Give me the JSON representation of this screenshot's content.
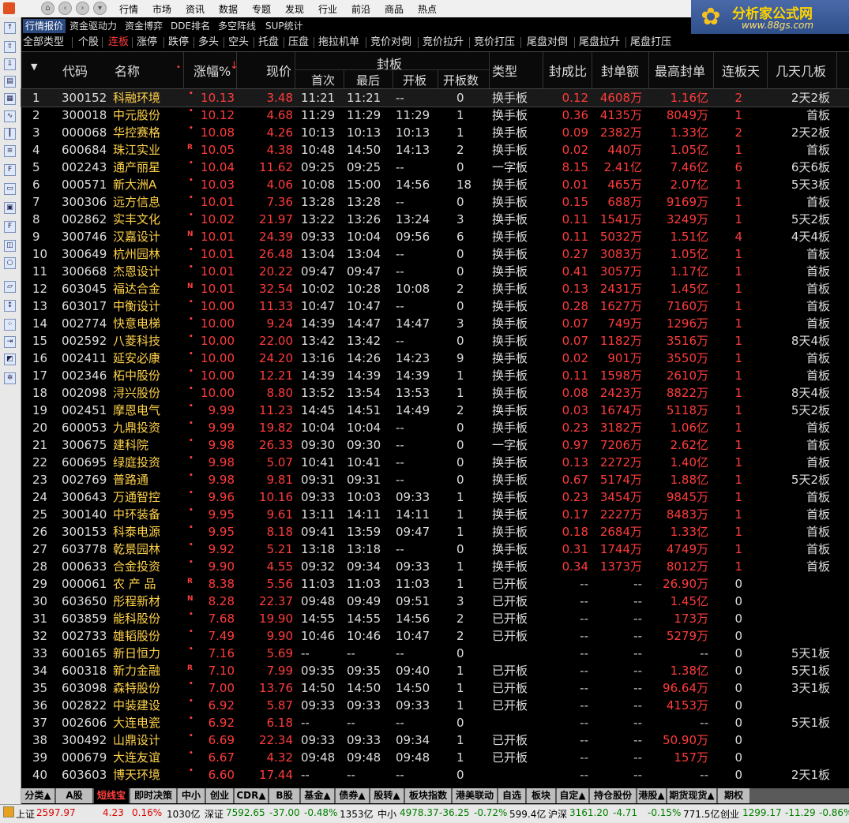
{
  "menubar": {
    "items": [
      "行情",
      "市场",
      "资讯",
      "数据",
      "专题",
      "发现",
      "行业",
      "前沿",
      "商品",
      "热点"
    ]
  },
  "brand": {
    "name": "分析家公式网",
    "url": "www.88gs.com"
  },
  "tabs_top": [
    "行情报价",
    "资金驱动力",
    "资金博弈",
    "DDE排名",
    "多空阵线",
    "SUP统计"
  ],
  "tabs_second": [
    {
      "label": "全部类型",
      "color": "w"
    },
    {
      "label": "个股",
      "color": "w"
    },
    {
      "label": "连板",
      "color": "r"
    },
    {
      "label": "涨停",
      "color": "w"
    },
    {
      "label": "跌停",
      "color": "w"
    },
    {
      "label": "多头",
      "color": "w"
    },
    {
      "label": "空头",
      "color": "w"
    },
    {
      "label": "托盘",
      "color": "w"
    },
    {
      "label": "压盘",
      "color": "w"
    },
    {
      "label": "拖拉机单",
      "color": "w"
    },
    {
      "label": "竞价对倒",
      "color": "w"
    },
    {
      "label": "竞价拉升",
      "color": "w"
    },
    {
      "label": "竞价打压",
      "color": "w"
    },
    {
      "label": "尾盘对倒",
      "color": "w"
    },
    {
      "label": "尾盘拉升",
      "color": "w"
    },
    {
      "label": "尾盘打压",
      "color": "w"
    }
  ],
  "columns": {
    "code": "代码",
    "name": "名称",
    "pct": "涨幅%",
    "price": "现价",
    "seal": "封板",
    "first": "首次",
    "last": "最后",
    "open": "开板",
    "opencount": "开板数",
    "type": "类型",
    "ratio": "封成比",
    "amount": "封单额",
    "maxseal": "最高封单",
    "days": "连板天",
    "nboards": "几天几板"
  },
  "rows": [
    {
      "n": "1",
      "code": "300152",
      "name": "科融环境",
      "mk": "",
      "pct": "10.13",
      "price": "3.48",
      "first": "11:21",
      "last": "11:21",
      "open": "--",
      "oc": "0",
      "type": "换手板",
      "ratio": "0.12",
      "amt": "4608万",
      "max": "1.16亿",
      "days": "2",
      "nb": "2天2板"
    },
    {
      "n": "2",
      "code": "300018",
      "name": "中元股份",
      "mk": "",
      "pct": "10.12",
      "price": "4.68",
      "first": "11:29",
      "last": "11:29",
      "open": "11:29",
      "oc": "1",
      "type": "换手板",
      "ratio": "0.36",
      "amt": "4135万",
      "max": "8049万",
      "days": "1",
      "nb": "首板"
    },
    {
      "n": "3",
      "code": "000068",
      "name": "华控赛格",
      "mk": "",
      "pct": "10.08",
      "price": "4.26",
      "first": "10:13",
      "last": "10:13",
      "open": "10:13",
      "oc": "1",
      "type": "换手板",
      "ratio": "0.09",
      "amt": "2382万",
      "max": "1.33亿",
      "days": "2",
      "nb": "2天2板"
    },
    {
      "n": "4",
      "code": "600684",
      "name": "珠江实业",
      "mk": "R",
      "pct": "10.05",
      "price": "4.38",
      "first": "10:48",
      "last": "14:50",
      "open": "14:13",
      "oc": "2",
      "type": "换手板",
      "ratio": "0.02",
      "amt": "440万",
      "max": "1.05亿",
      "days": "1",
      "nb": "首板"
    },
    {
      "n": "5",
      "code": "002243",
      "name": "通产丽星",
      "mk": "",
      "pct": "10.04",
      "price": "11.62",
      "first": "09:25",
      "last": "09:25",
      "open": "--",
      "oc": "0",
      "type": "一字板",
      "ratio": "8.15",
      "amt": "2.41亿",
      "max": "7.46亿",
      "days": "6",
      "nb": "6天6板"
    },
    {
      "n": "6",
      "code": "000571",
      "name": "新大洲A",
      "mk": "",
      "pct": "10.03",
      "price": "4.06",
      "first": "10:08",
      "last": "15:00",
      "open": "14:56",
      "oc": "18",
      "type": "换手板",
      "ratio": "0.01",
      "amt": "465万",
      "max": "2.07亿",
      "days": "1",
      "nb": "5天3板"
    },
    {
      "n": "7",
      "code": "300306",
      "name": "远方信息",
      "mk": "",
      "pct": "10.01",
      "price": "7.36",
      "first": "13:28",
      "last": "13:28",
      "open": "--",
      "oc": "0",
      "type": "换手板",
      "ratio": "0.15",
      "amt": "688万",
      "max": "9169万",
      "days": "1",
      "nb": "首板"
    },
    {
      "n": "8",
      "code": "002862",
      "name": "实丰文化",
      "mk": "",
      "pct": "10.02",
      "price": "21.97",
      "first": "13:22",
      "last": "13:26",
      "open": "13:24",
      "oc": "3",
      "type": "换手板",
      "ratio": "0.11",
      "amt": "1541万",
      "max": "3249万",
      "days": "1",
      "nb": "5天2板"
    },
    {
      "n": "9",
      "code": "300746",
      "name": "汉嘉设计",
      "mk": "N",
      "pct": "10.01",
      "price": "24.39",
      "first": "09:33",
      "last": "10:04",
      "open": "09:56",
      "oc": "6",
      "type": "换手板",
      "ratio": "0.11",
      "amt": "5032万",
      "max": "1.51亿",
      "days": "4",
      "nb": "4天4板"
    },
    {
      "n": "10",
      "code": "300649",
      "name": "杭州园林",
      "mk": "",
      "pct": "10.01",
      "price": "26.48",
      "first": "13:04",
      "last": "13:04",
      "open": "--",
      "oc": "0",
      "type": "换手板",
      "ratio": "0.27",
      "amt": "3083万",
      "max": "1.05亿",
      "days": "1",
      "nb": "首板"
    },
    {
      "n": "11",
      "code": "300668",
      "name": "杰恩设计",
      "mk": "",
      "pct": "10.01",
      "price": "20.22",
      "first": "09:47",
      "last": "09:47",
      "open": "--",
      "oc": "0",
      "type": "换手板",
      "ratio": "0.41",
      "amt": "3057万",
      "max": "1.17亿",
      "days": "1",
      "nb": "首板"
    },
    {
      "n": "12",
      "code": "603045",
      "name": "福达合金",
      "mk": "N",
      "pct": "10.01",
      "price": "32.54",
      "first": "10:02",
      "last": "10:28",
      "open": "10:08",
      "oc": "2",
      "type": "换手板",
      "ratio": "0.13",
      "amt": "2431万",
      "max": "1.45亿",
      "days": "1",
      "nb": "首板"
    },
    {
      "n": "13",
      "code": "603017",
      "name": "中衡设计",
      "mk": "",
      "pct": "10.00",
      "price": "11.33",
      "first": "10:47",
      "last": "10:47",
      "open": "--",
      "oc": "0",
      "type": "换手板",
      "ratio": "0.28",
      "amt": "1627万",
      "max": "7160万",
      "days": "1",
      "nb": "首板"
    },
    {
      "n": "14",
      "code": "002774",
      "name": "快意电梯",
      "mk": "",
      "pct": "10.00",
      "price": "9.24",
      "first": "14:39",
      "last": "14:47",
      "open": "14:47",
      "oc": "3",
      "type": "换手板",
      "ratio": "0.07",
      "amt": "749万",
      "max": "1296万",
      "days": "1",
      "nb": "首板"
    },
    {
      "n": "15",
      "code": "002592",
      "name": "八菱科技",
      "mk": "",
      "pct": "10.00",
      "price": "22.00",
      "first": "13:42",
      "last": "13:42",
      "open": "--",
      "oc": "0",
      "type": "换手板",
      "ratio": "0.07",
      "amt": "1182万",
      "max": "3516万",
      "days": "1",
      "nb": "8天4板"
    },
    {
      "n": "16",
      "code": "002411",
      "name": "延安必康",
      "mk": "",
      "pct": "10.00",
      "price": "24.20",
      "first": "13:16",
      "last": "14:26",
      "open": "14:23",
      "oc": "9",
      "type": "换手板",
      "ratio": "0.02",
      "amt": "901万",
      "max": "3550万",
      "days": "1",
      "nb": "首板"
    },
    {
      "n": "17",
      "code": "002346",
      "name": "柘中股份",
      "mk": "",
      "pct": "10.00",
      "price": "12.21",
      "first": "14:39",
      "last": "14:39",
      "open": "14:39",
      "oc": "1",
      "type": "换手板",
      "ratio": "0.11",
      "amt": "1598万",
      "max": "2610万",
      "days": "1",
      "nb": "首板"
    },
    {
      "n": "18",
      "code": "002098",
      "name": "浔兴股份",
      "mk": "",
      "pct": "10.00",
      "price": "8.80",
      "first": "13:52",
      "last": "13:54",
      "open": "13:53",
      "oc": "1",
      "type": "换手板",
      "ratio": "0.08",
      "amt": "2423万",
      "max": "8822万",
      "days": "1",
      "nb": "8天4板"
    },
    {
      "n": "19",
      "code": "002451",
      "name": "摩恩电气",
      "mk": "",
      "pct": "9.99",
      "price": "11.23",
      "first": "14:45",
      "last": "14:51",
      "open": "14:49",
      "oc": "2",
      "type": "换手板",
      "ratio": "0.03",
      "amt": "1674万",
      "max": "5118万",
      "days": "1",
      "nb": "5天2板"
    },
    {
      "n": "20",
      "code": "600053",
      "name": "九鼎投资",
      "mk": "",
      "pct": "9.99",
      "price": "19.82",
      "first": "10:04",
      "last": "10:04",
      "open": "--",
      "oc": "0",
      "type": "换手板",
      "ratio": "0.23",
      "amt": "3182万",
      "max": "1.06亿",
      "days": "1",
      "nb": "首板"
    },
    {
      "n": "21",
      "code": "300675",
      "name": "建科院",
      "mk": "",
      "pct": "9.98",
      "price": "26.33",
      "first": "09:30",
      "last": "09:30",
      "open": "--",
      "oc": "0",
      "type": "一字板",
      "ratio": "0.97",
      "amt": "7206万",
      "max": "2.62亿",
      "days": "1",
      "nb": "首板"
    },
    {
      "n": "22",
      "code": "600695",
      "name": "绿庭投资",
      "mk": "",
      "pct": "9.98",
      "price": "5.07",
      "first": "10:41",
      "last": "10:41",
      "open": "--",
      "oc": "0",
      "type": "换手板",
      "ratio": "0.13",
      "amt": "2272万",
      "max": "1.40亿",
      "days": "1",
      "nb": "首板"
    },
    {
      "n": "23",
      "code": "002769",
      "name": "普路通",
      "mk": "",
      "pct": "9.98",
      "price": "9.81",
      "first": "09:31",
      "last": "09:31",
      "open": "--",
      "oc": "0",
      "type": "换手板",
      "ratio": "0.67",
      "amt": "5174万",
      "max": "1.88亿",
      "days": "1",
      "nb": "5天2板"
    },
    {
      "n": "24",
      "code": "300643",
      "name": "万通智控",
      "mk": "",
      "pct": "9.96",
      "price": "10.16",
      "first": "09:33",
      "last": "10:03",
      "open": "09:33",
      "oc": "1",
      "type": "换手板",
      "ratio": "0.23",
      "amt": "3454万",
      "max": "9845万",
      "days": "1",
      "nb": "首板"
    },
    {
      "n": "25",
      "code": "300140",
      "name": "中环装备",
      "mk": "",
      "pct": "9.95",
      "price": "9.61",
      "first": "13:11",
      "last": "14:11",
      "open": "14:11",
      "oc": "1",
      "type": "换手板",
      "ratio": "0.17",
      "amt": "2227万",
      "max": "8483万",
      "days": "1",
      "nb": "首板"
    },
    {
      "n": "26",
      "code": "300153",
      "name": "科泰电源",
      "mk": "",
      "pct": "9.95",
      "price": "8.18",
      "first": "09:41",
      "last": "13:59",
      "open": "09:47",
      "oc": "1",
      "type": "换手板",
      "ratio": "0.18",
      "amt": "2684万",
      "max": "1.33亿",
      "days": "1",
      "nb": "首板"
    },
    {
      "n": "27",
      "code": "603778",
      "name": "乾景园林",
      "mk": "",
      "pct": "9.92",
      "price": "5.21",
      "first": "13:18",
      "last": "13:18",
      "open": "--",
      "oc": "0",
      "type": "换手板",
      "ratio": "0.31",
      "amt": "1744万",
      "max": "4749万",
      "days": "1",
      "nb": "首板"
    },
    {
      "n": "28",
      "code": "000633",
      "name": "合金投资",
      "mk": "",
      "pct": "9.90",
      "price": "4.55",
      "first": "09:32",
      "last": "09:34",
      "open": "09:33",
      "oc": "1",
      "type": "换手板",
      "ratio": "0.34",
      "amt": "1373万",
      "max": "8012万",
      "days": "1",
      "nb": "首板"
    },
    {
      "n": "29",
      "code": "000061",
      "name": "农 产 品",
      "mk": "R",
      "pct": "8.38",
      "price": "5.56",
      "first": "11:03",
      "last": "11:03",
      "open": "11:03",
      "oc": "1",
      "type": "已开板",
      "ratio": "--",
      "amt": "--",
      "max": "26.90万",
      "days": "0",
      "nb": ""
    },
    {
      "n": "30",
      "code": "603650",
      "name": "彤程新材",
      "mk": "N",
      "pct": "8.28",
      "price": "22.37",
      "first": "09:48",
      "last": "09:49",
      "open": "09:51",
      "oc": "3",
      "type": "已开板",
      "ratio": "--",
      "amt": "--",
      "max": "1.45亿",
      "days": "0",
      "nb": ""
    },
    {
      "n": "31",
      "code": "603859",
      "name": "能科股份",
      "mk": "",
      "pct": "7.68",
      "price": "19.90",
      "first": "14:55",
      "last": "14:55",
      "open": "14:56",
      "oc": "2",
      "type": "已开板",
      "ratio": "--",
      "amt": "--",
      "max": "173万",
      "days": "0",
      "nb": ""
    },
    {
      "n": "32",
      "code": "002733",
      "name": "雄韬股份",
      "mk": "",
      "pct": "7.49",
      "price": "9.90",
      "first": "10:46",
      "last": "10:46",
      "open": "10:47",
      "oc": "2",
      "type": "已开板",
      "ratio": "--",
      "amt": "--",
      "max": "5279万",
      "days": "0",
      "nb": ""
    },
    {
      "n": "33",
      "code": "600165",
      "name": "新日恒力",
      "mk": "",
      "pct": "7.16",
      "price": "5.69",
      "first": "--",
      "last": "--",
      "open": "--",
      "oc": "0",
      "type": "",
      "ratio": "--",
      "amt": "--",
      "max": "--",
      "days": "0",
      "nb": "5天1板"
    },
    {
      "n": "34",
      "code": "600318",
      "name": "新力金融",
      "mk": "R",
      "pct": "7.10",
      "price": "7.99",
      "first": "09:35",
      "last": "09:35",
      "open": "09:40",
      "oc": "1",
      "type": "已开板",
      "ratio": "--",
      "amt": "--",
      "max": "1.38亿",
      "days": "0",
      "nb": "5天1板"
    },
    {
      "n": "35",
      "code": "603098",
      "name": "森特股份",
      "mk": "",
      "pct": "7.00",
      "price": "13.76",
      "first": "14:50",
      "last": "14:50",
      "open": "14:50",
      "oc": "1",
      "type": "已开板",
      "ratio": "--",
      "amt": "--",
      "max": "96.64万",
      "days": "0",
      "nb": "3天1板"
    },
    {
      "n": "36",
      "code": "002822",
      "name": "中装建设",
      "mk": "",
      "pct": "6.92",
      "price": "5.87",
      "first": "09:33",
      "last": "09:33",
      "open": "09:33",
      "oc": "1",
      "type": "已开板",
      "ratio": "--",
      "amt": "--",
      "max": "4153万",
      "days": "0",
      "nb": ""
    },
    {
      "n": "37",
      "code": "002606",
      "name": "大连电瓷",
      "mk": "",
      "pct": "6.92",
      "price": "6.18",
      "first": "--",
      "last": "--",
      "open": "--",
      "oc": "0",
      "type": "",
      "ratio": "--",
      "amt": "--",
      "max": "--",
      "days": "0",
      "nb": "5天1板"
    },
    {
      "n": "38",
      "code": "300492",
      "name": "山鼎设计",
      "mk": "",
      "pct": "6.69",
      "price": "22.34",
      "first": "09:33",
      "last": "09:33",
      "open": "09:34",
      "oc": "1",
      "type": "已开板",
      "ratio": "--",
      "amt": "--",
      "max": "50.90万",
      "days": "0",
      "nb": ""
    },
    {
      "n": "39",
      "code": "000679",
      "name": "大连友谊",
      "mk": "",
      "pct": "6.67",
      "price": "4.32",
      "first": "09:48",
      "last": "09:48",
      "open": "09:48",
      "oc": "1",
      "type": "已开板",
      "ratio": "--",
      "amt": "--",
      "max": "157万",
      "days": "0",
      "nb": ""
    },
    {
      "n": "40",
      "code": "603603",
      "name": "博天环境",
      "mk": "",
      "pct": "6.60",
      "price": "17.44",
      "first": "--",
      "last": "--",
      "open": "--",
      "oc": "0",
      "type": "",
      "ratio": "--",
      "amt": "--",
      "max": "--",
      "days": "0",
      "nb": "2天1板"
    }
  ],
  "bottom_tabs": [
    "分类▲",
    "A股",
    "短线宝",
    "即时决策",
    "中小",
    "创业",
    "CDR▲",
    "B股",
    "基金▲",
    "债券▲",
    "股转▲",
    "板块指数",
    "港美联动",
    "自选",
    "板块",
    "自定▲",
    "持仓股份",
    "港股▲",
    "期货现货▲",
    "期权"
  ],
  "status": {
    "sh_label": "上证",
    "sh_val": "2597.97",
    "sh_chg": "4.23",
    "sh_pct": "0.16%",
    "sh_amt": "1030亿",
    "sz_label": "深证",
    "sz_val": "7592.65",
    "sz_chg": "-37.00",
    "sz_pct": "-0.48%",
    "sz_amt": "1353亿",
    "zx_label": "中小",
    "zx_val": "4978.37",
    "zx_chg": "-36.25",
    "zx_pct": "-0.72%",
    "zx_amt": "599.4亿",
    "hs_label": "沪深",
    "hs_val": "3161.20",
    "hs_chg": "-4.71",
    "hs_pct": "-0.15%",
    "hs_amt": "771.5亿",
    "cy_label": "创业",
    "cy_val": "1299.17",
    "cy_chg": "-11.29",
    "cy_pct": "-0.86%"
  },
  "colors": {
    "up": "#ff3c3c",
    "down": "#00c000",
    "code": "#ffd24a"
  }
}
